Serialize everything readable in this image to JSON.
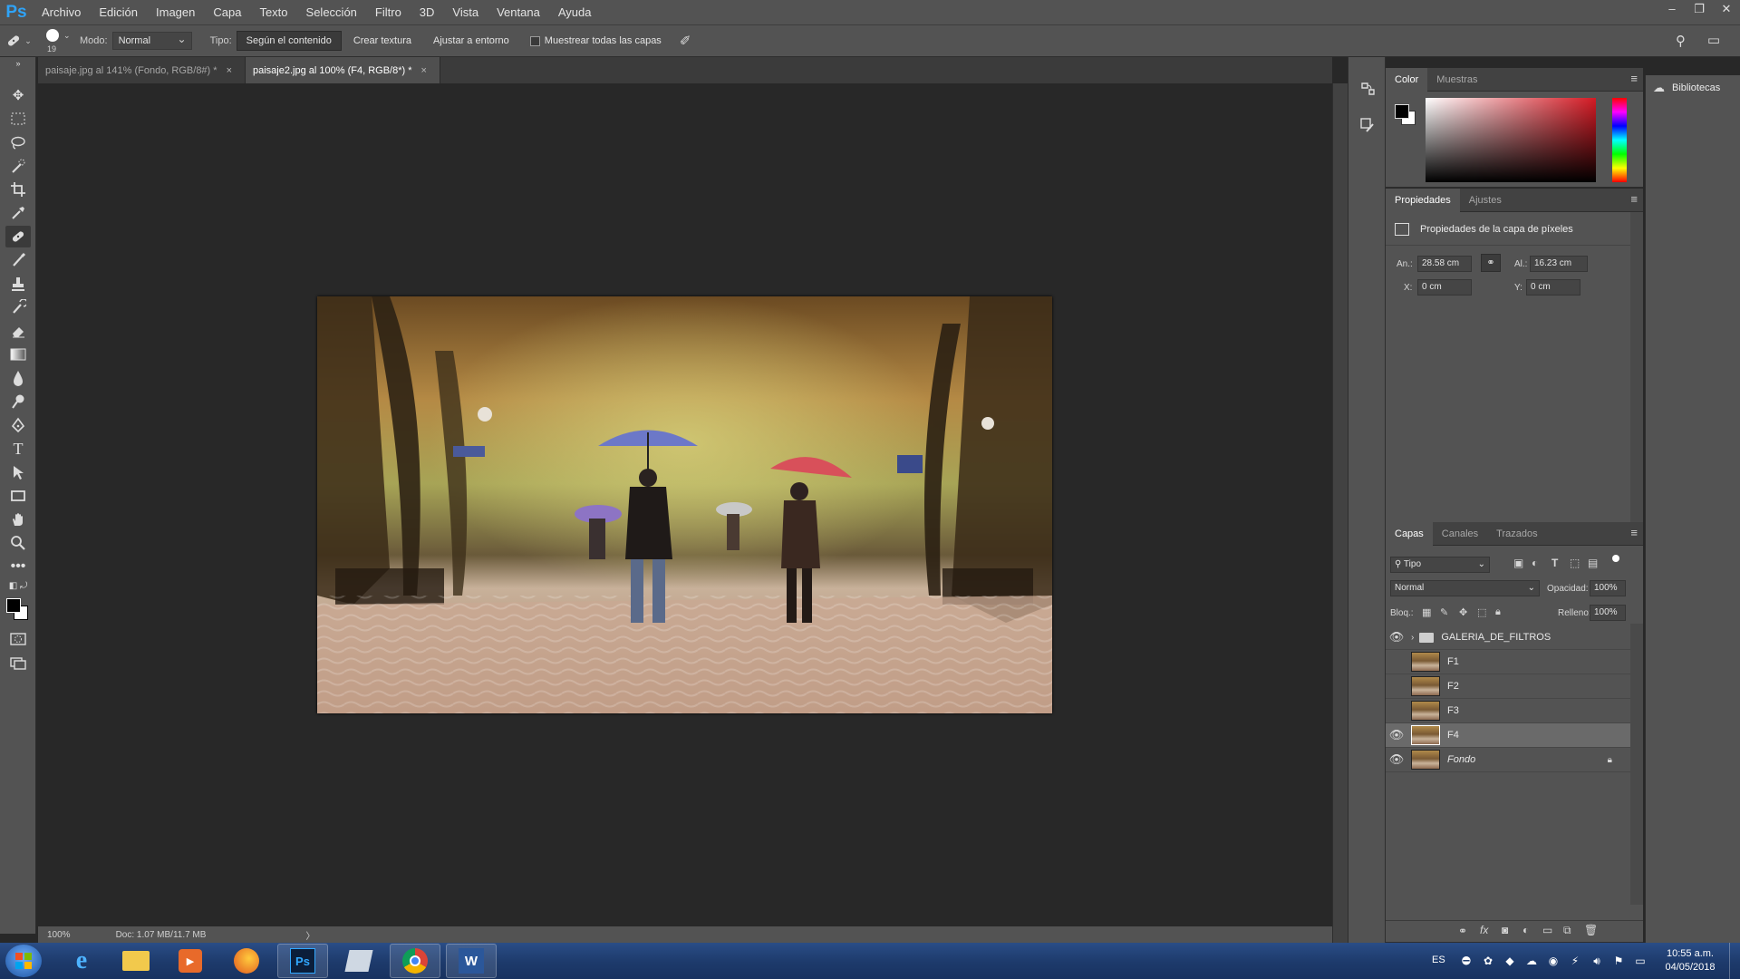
{
  "app": {
    "logo": "Ps"
  },
  "menu": [
    "Archivo",
    "Edición",
    "Imagen",
    "Capa",
    "Texto",
    "Selección",
    "Filtro",
    "3D",
    "Vista",
    "Ventana",
    "Ayuda"
  ],
  "window_controls": {
    "minimize": "–",
    "restore": "❐",
    "close": "✕"
  },
  "options": {
    "brush_size": "19",
    "mode_label": "Modo:",
    "mode_value": "Normal",
    "type_label": "Tipo:",
    "type_buttons": [
      "Según el contenido",
      "Crear textura",
      "Ajustar a entorno"
    ],
    "sample_all_label": "Muestrear todas las capas"
  },
  "tabs": [
    {
      "label": "paisaje.jpg al 141% (Fondo, RGB/8#) *",
      "close": "×"
    },
    {
      "label": "paisaje2.jpg al 100% (F4, RGB/8*) *",
      "close": "×"
    }
  ],
  "status": {
    "zoom": "100%",
    "doc": "Doc: 1.07 MB/11.7 MB",
    "arrow": "〉"
  },
  "color_panel": {
    "tabs": [
      "Color",
      "Muestras"
    ],
    "hue_color": "#d41a24",
    "fg": "#000000",
    "bg": "#ffffff"
  },
  "properties_panel": {
    "tabs": [
      "Propiedades",
      "Ajustes"
    ],
    "title": "Propiedades de la capa de píxeles",
    "width_label": "An.:",
    "width_value": "28.58 cm",
    "height_label": "Al.:",
    "height_value": "16.23 cm",
    "x_label": "X:",
    "x_value": "0 cm",
    "y_label": "Y:",
    "y_value": "0 cm"
  },
  "layers_panel": {
    "tabs": [
      "Capas",
      "Canales",
      "Trazados"
    ],
    "filter": "Tipo",
    "blend_mode": "Normal",
    "opacity_label": "Opacidad:",
    "opacity_value": "100%",
    "lock_label": "Bloq.:",
    "fill_label": "Relleno:",
    "fill_value": "100%",
    "layers": [
      {
        "name": "GALERIA_DE_FILTROS",
        "visible": true,
        "type": "group"
      },
      {
        "name": "F1",
        "visible": false,
        "type": "pixel"
      },
      {
        "name": "F2",
        "visible": false,
        "type": "pixel"
      },
      {
        "name": "F3",
        "visible": false,
        "type": "pixel"
      },
      {
        "name": "F4",
        "visible": true,
        "type": "pixel",
        "selected": true
      },
      {
        "name": "Fondo",
        "visible": true,
        "type": "background"
      }
    ]
  },
  "libraries": {
    "label": "Bibliotecas"
  },
  "taskbar": {
    "lang": "ES",
    "time": "10:55 a.m.",
    "date": "04/05/2018"
  }
}
